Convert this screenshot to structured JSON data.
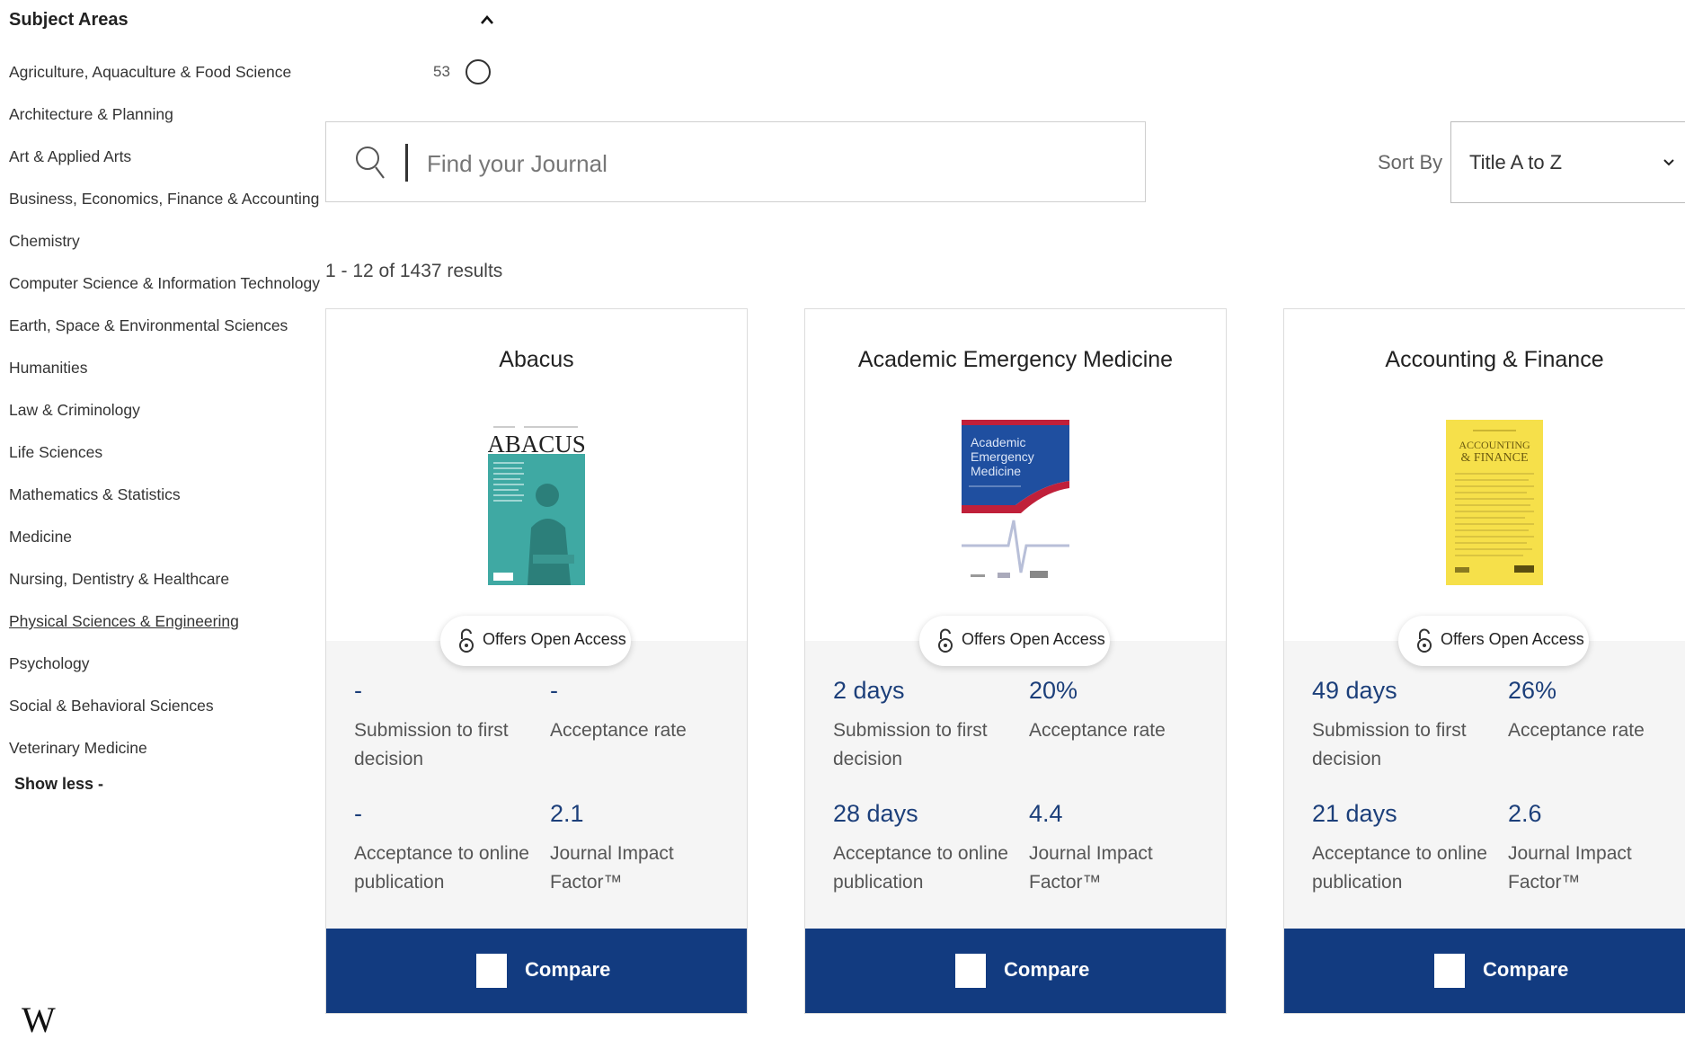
{
  "sidebar": {
    "title": "Subject Areas",
    "items": [
      {
        "label": "Agriculture, Aquaculture & Food Science"
      },
      {
        "label": "Architecture & Planning"
      },
      {
        "label": "Art & Applied Arts"
      },
      {
        "label": "Business, Economics, Finance & Accounting"
      },
      {
        "label": "Chemistry"
      },
      {
        "label": "Computer Science & Information Technology"
      },
      {
        "label": "Earth, Space & Environmental Sciences"
      },
      {
        "label": "Humanities"
      },
      {
        "label": "Law & Criminology"
      },
      {
        "label": "Life Sciences"
      },
      {
        "label": "Mathematics & Statistics"
      },
      {
        "label": "Medicine"
      },
      {
        "label": "Nursing, Dentistry & Healthcare"
      },
      {
        "label": "Physical Sciences & Engineering"
      },
      {
        "label": "Psychology"
      },
      {
        "label": "Social & Behavioral Sciences"
      },
      {
        "label": "Veterinary Medicine"
      }
    ],
    "show_less": "Show less -",
    "first_item_count": "53"
  },
  "search": {
    "placeholder": "Find your Journal"
  },
  "sort": {
    "label": "Sort By",
    "value": "Title A to Z"
  },
  "results_text": "1 - 12 of 1437 results",
  "oa_label": "Offers Open Access",
  "compare_label": "Compare",
  "metric_labels": {
    "submission": "Submission to first decision",
    "acceptance": "Acceptance rate",
    "online": "Acceptance to online publication",
    "impact": "Journal Impact Factor™"
  },
  "cards": [
    {
      "title": "Abacus",
      "cover_text": "ABACUS",
      "cover_color": "#3fa9a3",
      "submission": "-",
      "acceptance": "-",
      "online": "-",
      "impact": "2.1"
    },
    {
      "title": "Academic Emergency Medicine",
      "cover_text": "Academic Emergency Medicine",
      "cover_color": "#1f4fa0",
      "submission": "2 days",
      "acceptance": "20%",
      "online": "28 days",
      "impact": "4.4"
    },
    {
      "title": "Accounting & Finance",
      "cover_text": "ACCOUNTING & FINANCE",
      "cover_color": "#f6e04a",
      "submission": "49 days",
      "acceptance": "26%",
      "online": "21 days",
      "impact": "2.6"
    }
  ],
  "colors": {
    "brand_blue": "#123b80",
    "metric_blue": "#1c3f7a"
  }
}
